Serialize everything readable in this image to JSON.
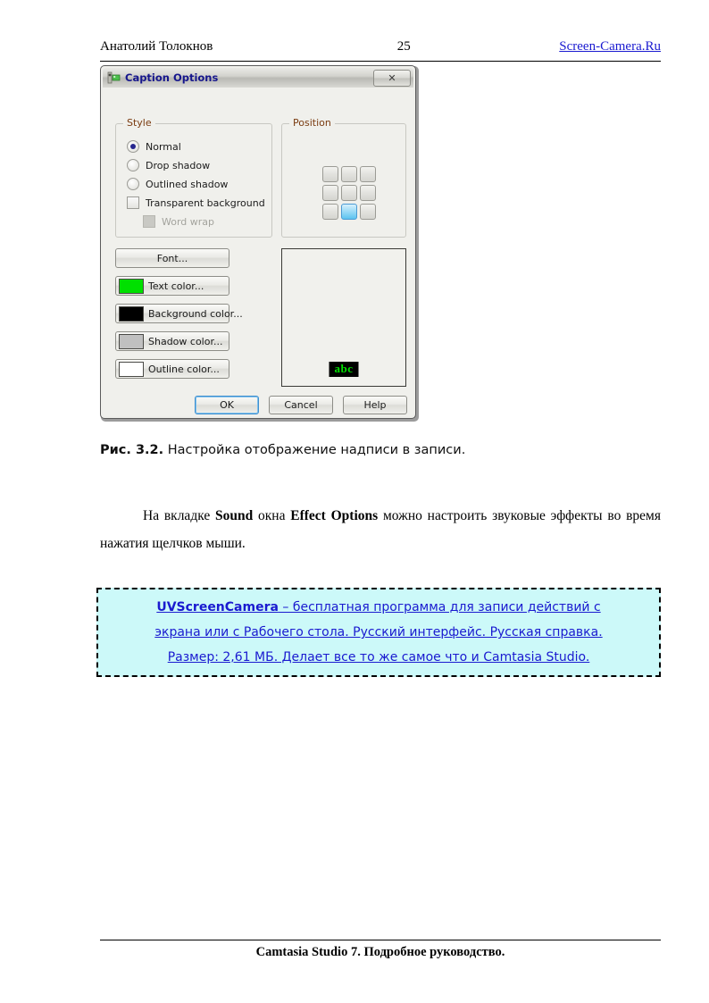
{
  "page": {
    "header": {
      "author": "Анатолий Толокнов",
      "page_number": "25",
      "site_link": "Screen-Camera.Ru"
    },
    "figure_caption": {
      "label": "Рис. 3.2.",
      "text": " Настройка отображение надписи в записи."
    },
    "paragraph": {
      "part1": "На вкладке ",
      "bold1": "Sound",
      "part2": " окна ",
      "bold2": "Effect Options",
      "part3": " можно настроить звуковые эффекты во время нажатия щелчков мыши."
    },
    "ad_box": {
      "line1_bold": "UVScreenCamera",
      "line1_rest": " – бесплатная программа для записи действий с",
      "line2": "экрана или с Рабочего стола. Русский интерфейс. Русская справка.",
      "line3": "Размер: 2,61 МБ. Делает все то же самое что и Camtasia Studio.",
      "background_color": "#ccf9f9",
      "link_color": "#1a1ad0"
    },
    "footer": {
      "text": "Camtasia Studio 7. Подробное руководство."
    }
  },
  "dialog": {
    "title": "Caption Options",
    "title_icon": "caption-icon",
    "close_label": "✕",
    "style_group": {
      "title": "Style",
      "options": [
        {
          "label": "Normal",
          "type": "radio",
          "checked": true,
          "disabled": false
        },
        {
          "label": "Drop shadow",
          "type": "radio",
          "checked": false,
          "disabled": false
        },
        {
          "label": "Outlined shadow",
          "type": "radio",
          "checked": false,
          "disabled": false
        },
        {
          "label": "Transparent background",
          "type": "checkbox",
          "checked": false,
          "disabled": false
        },
        {
          "label": "Word wrap",
          "type": "checkbox",
          "checked": false,
          "disabled": true
        }
      ]
    },
    "position_group": {
      "title": "Position",
      "cells": [
        {
          "name": "top-left",
          "selected": false
        },
        {
          "name": "top-center",
          "selected": false
        },
        {
          "name": "top-right",
          "selected": false
        },
        {
          "name": "middle-left",
          "selected": false
        },
        {
          "name": "middle-center",
          "selected": false
        },
        {
          "name": "middle-right",
          "selected": false
        },
        {
          "name": "bottom-left",
          "selected": false
        },
        {
          "name": "bottom-center",
          "selected": true
        },
        {
          "name": "bottom-right",
          "selected": false
        }
      ],
      "selected_position": "bottom-center",
      "selected_color": "#5cc3f0"
    },
    "buttons": {
      "font": "Font...",
      "text_color": "Text color...",
      "text_color_value": "#00e000",
      "background_color": "Background color...",
      "background_color_value": "#000000",
      "shadow_color": "Shadow color...",
      "shadow_color_value": "#c0c0c0",
      "outline_color": "Outline color...",
      "outline_color_value": "#ffffff"
    },
    "preview": {
      "sample_text": "abc",
      "text_color": "#00e000",
      "background_color": "#000000",
      "position": "bottom-center"
    },
    "actions": {
      "ok": "OK",
      "cancel": "Cancel",
      "help": "Help"
    }
  }
}
